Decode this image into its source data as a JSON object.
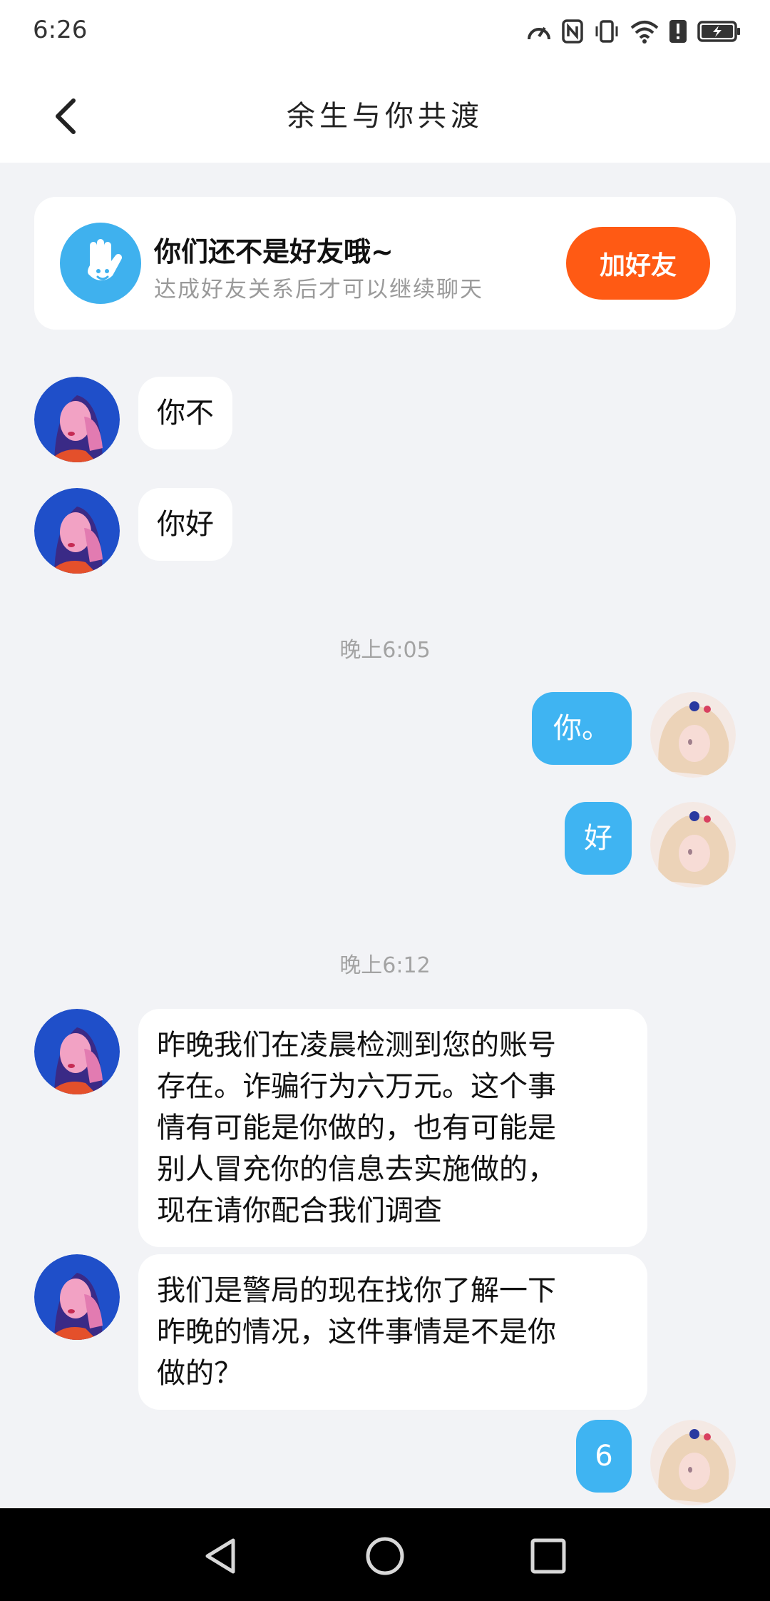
{
  "status_bar": {
    "time": "6:26",
    "icons": [
      "speed-icon",
      "nfc-icon",
      "vibrate-icon",
      "wifi-icon",
      "alert-icon",
      "battery-icon"
    ]
  },
  "header": {
    "title": "余生与你共渡",
    "back_icon": "chevron-left-icon"
  },
  "notice": {
    "icon": "hand-wave-icon",
    "title": "你们还不是好友哦~",
    "subtitle": "达成好友关系后才可以继续聊天",
    "button_label": "加好友"
  },
  "messages": [
    {
      "side": "in",
      "text": "你不"
    },
    {
      "side": "in",
      "text": "你好"
    },
    {
      "timestamp": "晚上6:05"
    },
    {
      "side": "out",
      "text": "你。"
    },
    {
      "side": "out",
      "text": "好"
    },
    {
      "timestamp": "晚上6:12"
    },
    {
      "side": "in",
      "lines": [
        "昨晚我们在凌晨检测到您的账号",
        "存在。诈骗行为六万元。这个事",
        "情有可能是你做的，也有可能是",
        "别人冒充你的信息去实施做的，",
        "现在请你配合我们调查"
      ]
    },
    {
      "side": "in",
      "lines": [
        "我们是警局的现在找你了解一下",
        "昨晚的情况，这件事情是不是你",
        "做的？"
      ]
    },
    {
      "side": "out",
      "text": "6"
    }
  ],
  "nav_bar": {
    "back_icon": "triangle-back-icon",
    "home_icon": "circle-home-icon",
    "recents_icon": "square-recents-icon"
  },
  "colors": {
    "accent_blue": "#3fb4f2",
    "add_friend_orange": "#ff5a14",
    "background": "#f2f3f6"
  }
}
